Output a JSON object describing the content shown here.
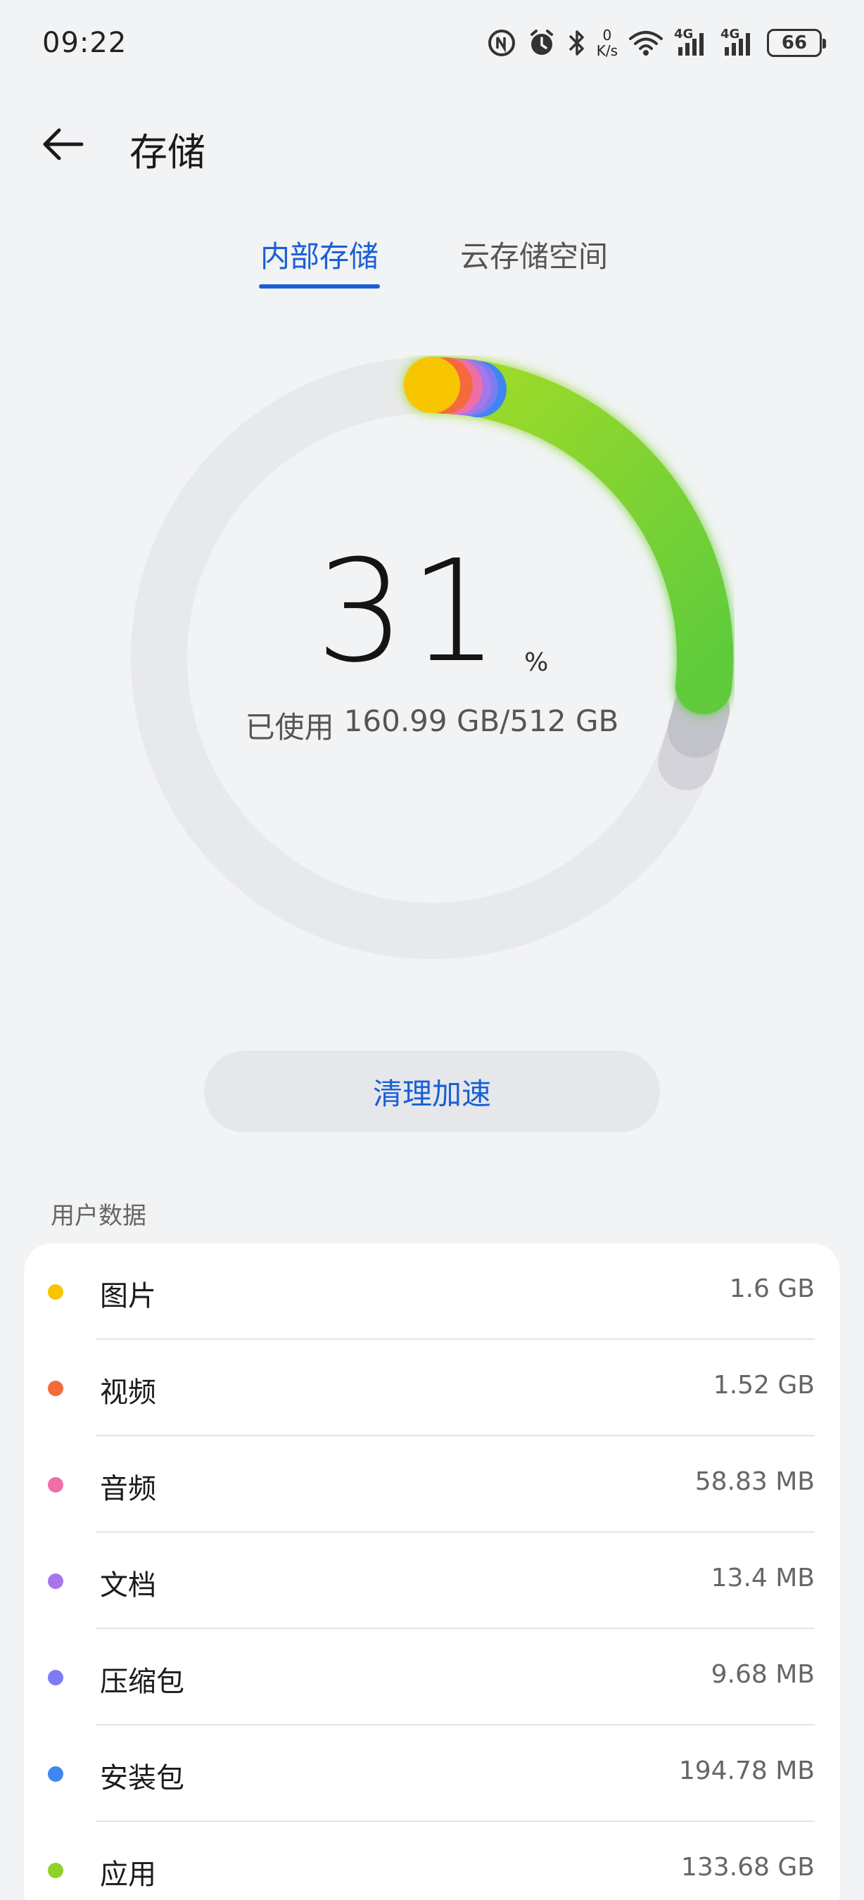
{
  "status_bar": {
    "time": "09:22",
    "net_speed_value": "0",
    "net_speed_unit": "K/s",
    "signal_1_label": "4G",
    "signal_2_label": "4G",
    "battery": "66"
  },
  "header": {
    "title": "存储"
  },
  "tabs": [
    {
      "label": "内部存储",
      "active": true
    },
    {
      "label": "云存储空间",
      "active": false
    }
  ],
  "usage": {
    "percent": "31",
    "percent_sign": "%",
    "used_label": "已使用",
    "used_amount": "160.99 GB/512 GB"
  },
  "clean_button": {
    "label": "清理加速"
  },
  "section": {
    "label": "用户数据"
  },
  "categories": [
    {
      "label": "图片",
      "value": "1.6 GB",
      "color": "#f7c600"
    },
    {
      "label": "视频",
      "value": "1.52 GB",
      "color": "#f46a3d"
    },
    {
      "label": "音频",
      "value": "58.83 MB",
      "color": "#ee6fa6"
    },
    {
      "label": "文档",
      "value": "13.4 MB",
      "color": "#a577e8"
    },
    {
      "label": "压缩包",
      "value": "9.68 MB",
      "color": "#7c7cf2"
    },
    {
      "label": "安装包",
      "value": "194.78 MB",
      "color": "#3f86f0"
    },
    {
      "label": "应用",
      "value": "133.68 GB",
      "color": "#8fd22a"
    }
  ],
  "colors": {
    "accent": "#1a5fd6",
    "ring_track": "#e8e9eb",
    "ring_apps_start": "#98d92c",
    "ring_apps_end": "#62cc3a",
    "ring_system": "#c4c4cc"
  }
}
